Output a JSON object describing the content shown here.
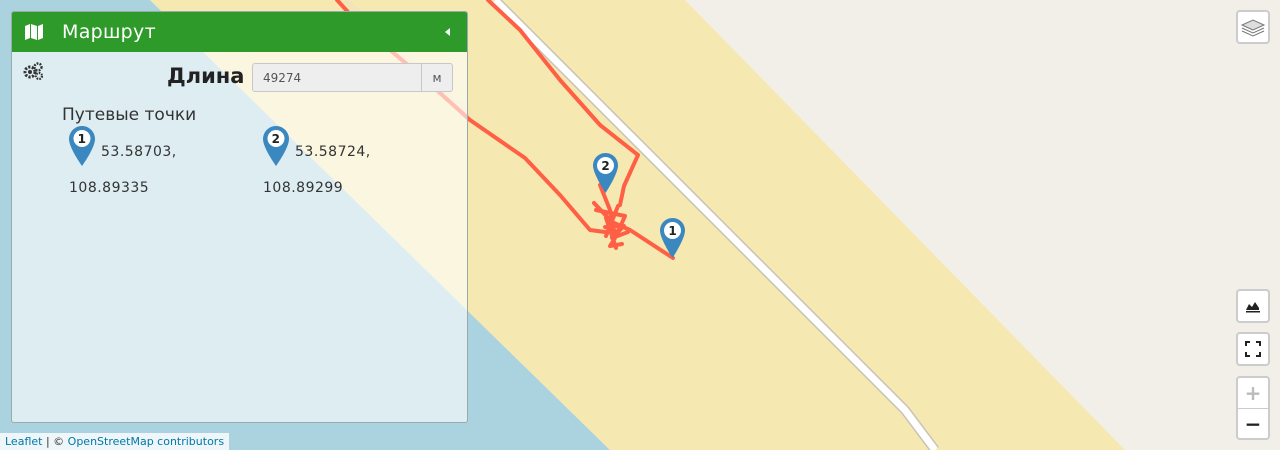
{
  "panel": {
    "title": "Маршрут",
    "length_label": "Длина",
    "length_value": "49274",
    "length_unit": "м",
    "waypoints_heading": "Путевые точки",
    "waypoints": [
      {
        "number": "1",
        "lat": "53.58703,",
        "lng": "108.89335"
      },
      {
        "number": "2",
        "lat": "53.58724,",
        "lng": "108.89299"
      }
    ]
  },
  "map": {
    "markers": [
      {
        "number": "1"
      },
      {
        "number": "2"
      }
    ],
    "colors": {
      "water": "#aad3df",
      "sand": "#f6e8b1",
      "land": "#f2efe9",
      "route": "#ff5f45",
      "header": "#2e9a2a",
      "marker": "#3b87c0"
    }
  },
  "controls": {
    "icons": [
      "layers-icon",
      "elevation-icon",
      "fullscreen-icon"
    ],
    "zoom_in": "+",
    "zoom_out": "−"
  },
  "attribution": {
    "leaflet": "Leaflet",
    "separator": " | © ",
    "osm": "OpenStreetMap contributors"
  }
}
